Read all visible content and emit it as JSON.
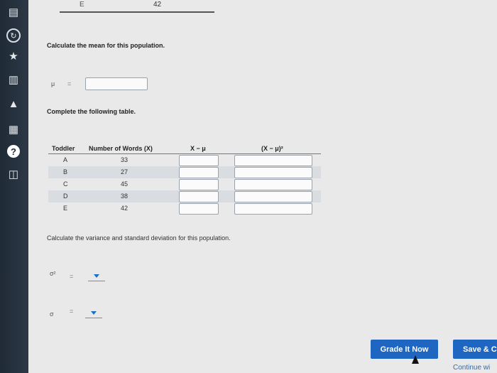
{
  "sidebar": {
    "icons": [
      "clipboard-icon",
      "refresh-icon",
      "star-icon",
      "book-icon",
      "graduation-cap-icon",
      "calculator-icon",
      "help-icon",
      "library-icon"
    ],
    "help_glyph": "?"
  },
  "top": {
    "toddler": "E",
    "words": "42"
  },
  "mean_section": {
    "prompt": "Calculate the mean for this population.",
    "mu_symbol": "μ",
    "equals": "=",
    "mu_value": ""
  },
  "table_section": {
    "prompt": "Complete the following table.",
    "headers": {
      "toddler": "Toddler",
      "words": "Number of Words (X)",
      "x_minus_mu": "X − μ",
      "sq_dev": "(X − μ)²"
    },
    "rows": [
      {
        "toddler": "A",
        "words": "33"
      },
      {
        "toddler": "B",
        "words": "27"
      },
      {
        "toddler": "C",
        "words": "45"
      },
      {
        "toddler": "D",
        "words": "38"
      },
      {
        "toddler": "E",
        "words": "42"
      }
    ]
  },
  "variance_section": {
    "prompt": "Calculate the variance and standard deviation for this population.",
    "variance_symbol": "σ²",
    "std_symbol": "σ",
    "equals": "="
  },
  "buttons": {
    "grade": "Grade It Now",
    "save": "Save & C",
    "continue": "Continue wi"
  },
  "colors": {
    "accent": "#1f66c2",
    "sidebar": "#1f2a36",
    "row_shade": "#d9dde2"
  }
}
